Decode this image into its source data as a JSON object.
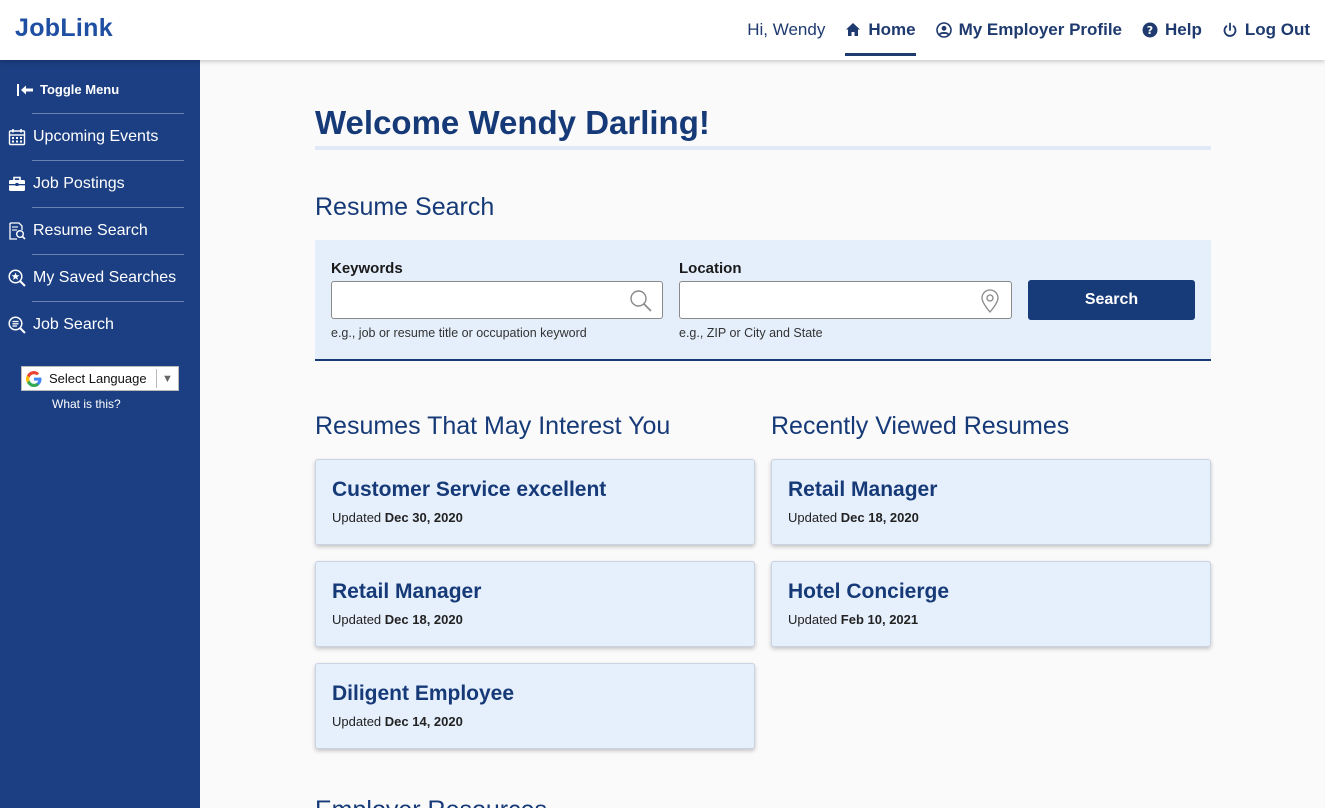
{
  "header": {
    "brand": "JobLink",
    "greeting": "Hi, Wendy",
    "nav": [
      {
        "label": "Home",
        "icon": "home-icon"
      },
      {
        "label": "My Employer Profile",
        "icon": "user-circle-icon"
      },
      {
        "label": "Help",
        "icon": "help-icon"
      },
      {
        "label": "Log Out",
        "icon": "power-icon"
      }
    ]
  },
  "sidebar": {
    "toggle_label": "Toggle Menu",
    "items": [
      {
        "label": "Upcoming Events",
        "icon": "calendar-icon"
      },
      {
        "label": "Job Postings",
        "icon": "briefcase-icon"
      },
      {
        "label": "Resume Search",
        "icon": "document-search-icon"
      },
      {
        "label": "My Saved Searches",
        "icon": "star-search-icon"
      },
      {
        "label": "Job Search",
        "icon": "search-list-icon"
      }
    ],
    "language_select": "Select Language",
    "language_help": "What is this?"
  },
  "main": {
    "welcome": "Welcome Wendy Darling!",
    "resume_search": {
      "heading": "Resume Search",
      "keywords_label": "Keywords",
      "keywords_value": "",
      "keywords_hint": "e.g., job or resume title or occupation keyword",
      "location_label": "Location",
      "location_value": "",
      "location_hint": "e.g., ZIP or City and State",
      "search_button": "Search"
    },
    "interest": {
      "heading": "Resumes That May Interest You",
      "updated_prefix": "Updated",
      "items": [
        {
          "title": "Customer Service excellent",
          "date": "Dec 30, 2020"
        },
        {
          "title": "Retail Manager",
          "date": "Dec 18, 2020"
        },
        {
          "title": "Diligent Employee",
          "date": "Dec 14, 2020"
        }
      ]
    },
    "recent": {
      "heading": "Recently Viewed Resumes",
      "updated_prefix": "Updated",
      "items": [
        {
          "title": "Retail Manager",
          "date": "Dec 18, 2020"
        },
        {
          "title": "Hotel Concierge",
          "date": "Feb 10, 2021"
        }
      ]
    },
    "partial_heading": "Employer Resources"
  },
  "colors": {
    "brand": "#1f4fa3",
    "sidebar_bg": "#1b3f82",
    "accent_dark": "#163a77",
    "panel_bg": "#e5effc"
  }
}
